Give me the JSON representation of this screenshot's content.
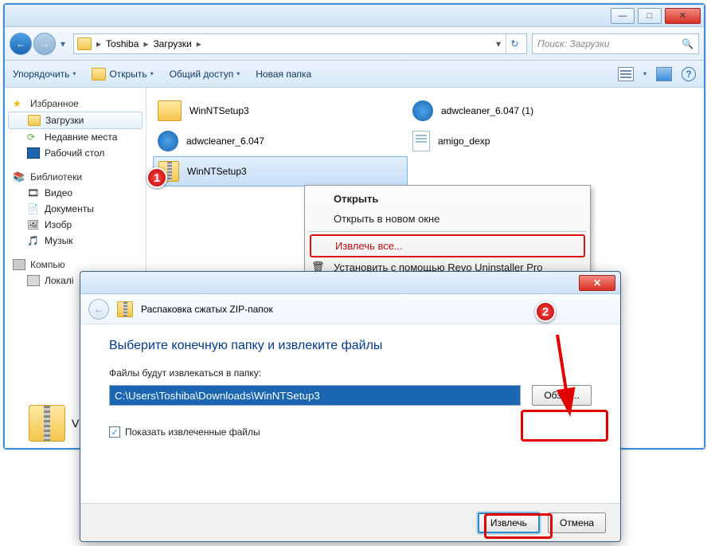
{
  "window_controls": {
    "min": "—",
    "max": "□",
    "close": "✕"
  },
  "nav": {
    "dropdown": "▾",
    "path_root": "Toshiba",
    "path_folder": "Загрузки",
    "chevron": "▸",
    "refresh": "↻",
    "search_placeholder": "Поиск: Загрузки",
    "back_glyph": "←",
    "fwd_glyph": "→"
  },
  "toolbar": {
    "organize": "Упорядочить",
    "open": "Открыть",
    "share": "Общий доступ",
    "new_folder": "Новая папка",
    "help": "?"
  },
  "tree": {
    "favorites": "Избранное",
    "downloads": "Загрузки",
    "recent": "Недавние места",
    "desktop": "Рабочий стол",
    "libraries": "Библиотеки",
    "video": "Видео",
    "documents": "Документы",
    "images": "Изобр",
    "music": "Музык",
    "computer": "Компью",
    "local": "Локалі",
    "zip_short": "V"
  },
  "files": {
    "f0": "WinNTSetup3",
    "f1": "adwcleaner_6.047",
    "f2": "WinNTSetup3",
    "g0": "adwcleaner_6.047 (1)",
    "g1": "amigo_dexp"
  },
  "context": {
    "open": "Открыть",
    "open_new": "Открыть в новом окне",
    "extract_all": "Извлечь все...",
    "revo": "Установить с помощью Revo Uninstaller Pro"
  },
  "dialog": {
    "header": "Распаковка сжатых ZIP-папок",
    "title": "Выберите конечную папку и извлеките файлы",
    "label": "Файлы будут извлекаться в папку:",
    "path": "C:\\Users\\Toshiba\\Downloads\\WinNTSetup3",
    "browse": "Обзор...",
    "show_files": "Показать извлеченные файлы",
    "extract": "Извлечь",
    "cancel": "Отмена",
    "close": "✕",
    "back": "←",
    "check": "✓"
  },
  "markers": {
    "m1": "1",
    "m2": "2"
  }
}
